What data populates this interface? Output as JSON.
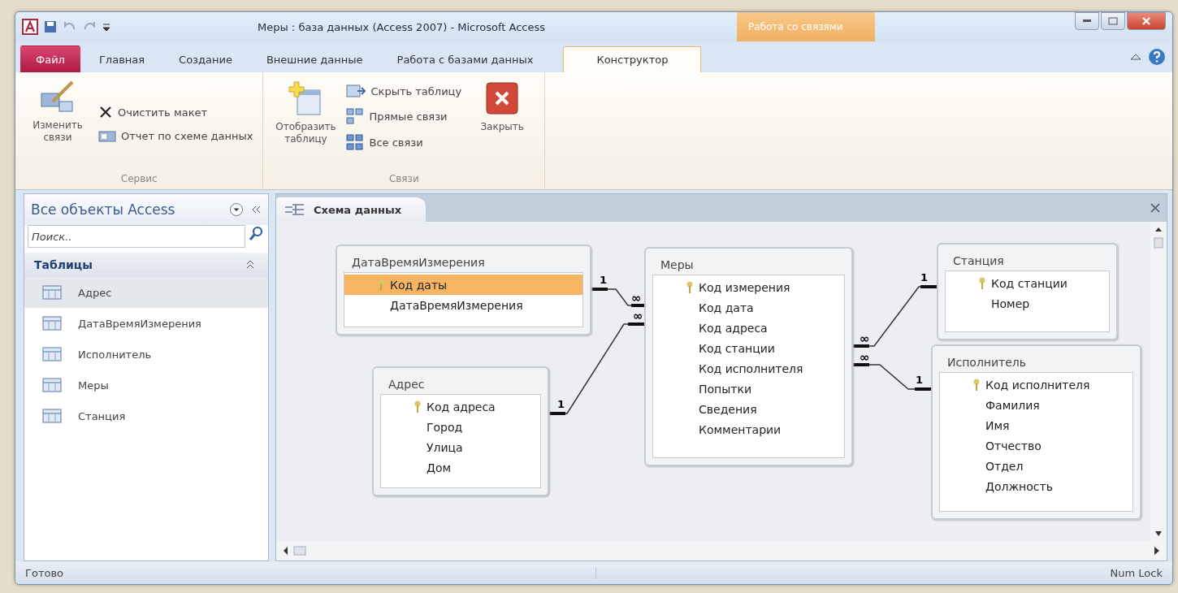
{
  "window": {
    "title": "Меры : база данных (Access 2007)  -  Microsoft Access",
    "context_tab": "Работа со связями"
  },
  "ribbon_tabs": [
    {
      "label": "Файл",
      "kind": "file",
      "selected": false
    },
    {
      "label": "Главная",
      "kind": "tab",
      "selected": false
    },
    {
      "label": "Создание",
      "kind": "tab",
      "selected": false
    },
    {
      "label": "Внешние данные",
      "kind": "tab",
      "selected": false
    },
    {
      "label": "Работа с базами данных",
      "kind": "tab",
      "selected": false
    },
    {
      "label": "Конструктор",
      "kind": "tab",
      "selected": true
    }
  ],
  "ribbon_groups": [
    {
      "label": "Сервис",
      "items": [
        {
          "kind": "large",
          "label": "Изменить связи"
        },
        {
          "kind": "small",
          "label": "Очистить макет"
        },
        {
          "kind": "small",
          "label": "Отчет по схеме данных"
        }
      ]
    },
    {
      "label": "Связи",
      "items": [
        {
          "kind": "large",
          "label": "Отобразить таблицу"
        },
        {
          "kind": "small",
          "label": "Скрыть таблицу"
        },
        {
          "kind": "small",
          "label": "Прямые связи"
        },
        {
          "kind": "small",
          "label": "Все связи"
        },
        {
          "kind": "large",
          "label": "Закрыть"
        }
      ]
    }
  ],
  "nav_pane": {
    "title": "Все объекты Access",
    "search": {
      "placeholder": "Поиск.."
    },
    "group": "Таблицы",
    "items": [
      {
        "label": "Адрес",
        "selected": true
      },
      {
        "label": "ДатаВремяИзмерения",
        "selected": false
      },
      {
        "label": "Исполнитель",
        "selected": false
      },
      {
        "label": "Меры",
        "selected": false
      },
      {
        "label": "Станция",
        "selected": false
      }
    ]
  },
  "document_tab": {
    "label": "Схема данных"
  },
  "tables": [
    {
      "name": "ДатаВремяИзмерения",
      "fields": [
        {
          "label": "Код даты",
          "primary_key": true,
          "selected": true
        },
        {
          "label": "ДатаВремяИзмерения",
          "primary_key": false,
          "selected": false
        }
      ]
    },
    {
      "name": "Адрес",
      "fields": [
        {
          "label": "Код адреса",
          "primary_key": true,
          "selected": false
        },
        {
          "label": "Город",
          "primary_key": false,
          "selected": false
        },
        {
          "label": "Улица",
          "primary_key": false,
          "selected": false
        },
        {
          "label": "Дом",
          "primary_key": false,
          "selected": false
        }
      ]
    },
    {
      "name": "Меры",
      "fields": [
        {
          "label": "Код измерения",
          "primary_key": true,
          "selected": false
        },
        {
          "label": "Код дата",
          "primary_key": false,
          "selected": false
        },
        {
          "label": "Код адреса",
          "primary_key": false,
          "selected": false
        },
        {
          "label": "Код станции",
          "primary_key": false,
          "selected": false
        },
        {
          "label": "Код исполнителя",
          "primary_key": false,
          "selected": false
        },
        {
          "label": "Попытки",
          "primary_key": false,
          "selected": false
        },
        {
          "label": "Сведения",
          "primary_key": false,
          "selected": false
        },
        {
          "label": "Комментарии",
          "primary_key": false,
          "selected": false
        }
      ]
    },
    {
      "name": "Станция",
      "fields": [
        {
          "label": "Код станции",
          "primary_key": true,
          "selected": false
        },
        {
          "label": "Номер",
          "primary_key": false,
          "selected": false
        }
      ]
    },
    {
      "name": "Исполнитель",
      "fields": [
        {
          "label": "Код исполнителя",
          "primary_key": true,
          "selected": false
        },
        {
          "label": "Фамилия",
          "primary_key": false,
          "selected": false
        },
        {
          "label": "Имя",
          "primary_key": false,
          "selected": false
        },
        {
          "label": "Отчество",
          "primary_key": false,
          "selected": false
        },
        {
          "label": "Отдел",
          "primary_key": false,
          "selected": false
        },
        {
          "label": "Должность",
          "primary_key": false,
          "selected": false
        }
      ]
    }
  ],
  "relationships": [
    {
      "one": "1",
      "many": "∞"
    },
    {
      "one": "1",
      "many": "∞"
    },
    {
      "one": "1",
      "many": "∞"
    },
    {
      "one": "1",
      "many": "∞"
    }
  ],
  "status_bar": {
    "left": "Готово",
    "right": "Num Lock"
  }
}
